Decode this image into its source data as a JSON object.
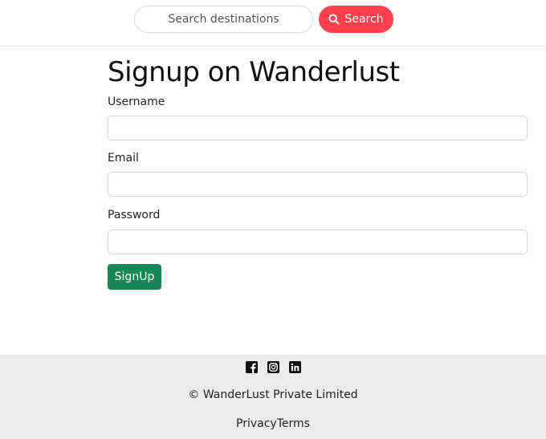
{
  "header": {
    "search": {
      "placeholder": "Search destinations",
      "value": ""
    },
    "search_button": {
      "label": "Search",
      "icon": "search-icon",
      "color": "#fe424d"
    }
  },
  "main": {
    "title": "Signup on Wanderlust",
    "fields": [
      {
        "label": "Username",
        "value": ""
      },
      {
        "label": "Email",
        "value": ""
      },
      {
        "label": "Password",
        "value": ""
      }
    ],
    "submit_button": {
      "label": "SignUp",
      "color": "#198754"
    }
  },
  "footer": {
    "socials": [
      "facebook-icon",
      "instagram-icon",
      "linkedin-icon"
    ],
    "copyright": "© WanderLust Private Limited",
    "links": [
      {
        "label": "Privacy"
      },
      {
        "label": "Terms"
      }
    ],
    "background": "#ebebeb"
  }
}
